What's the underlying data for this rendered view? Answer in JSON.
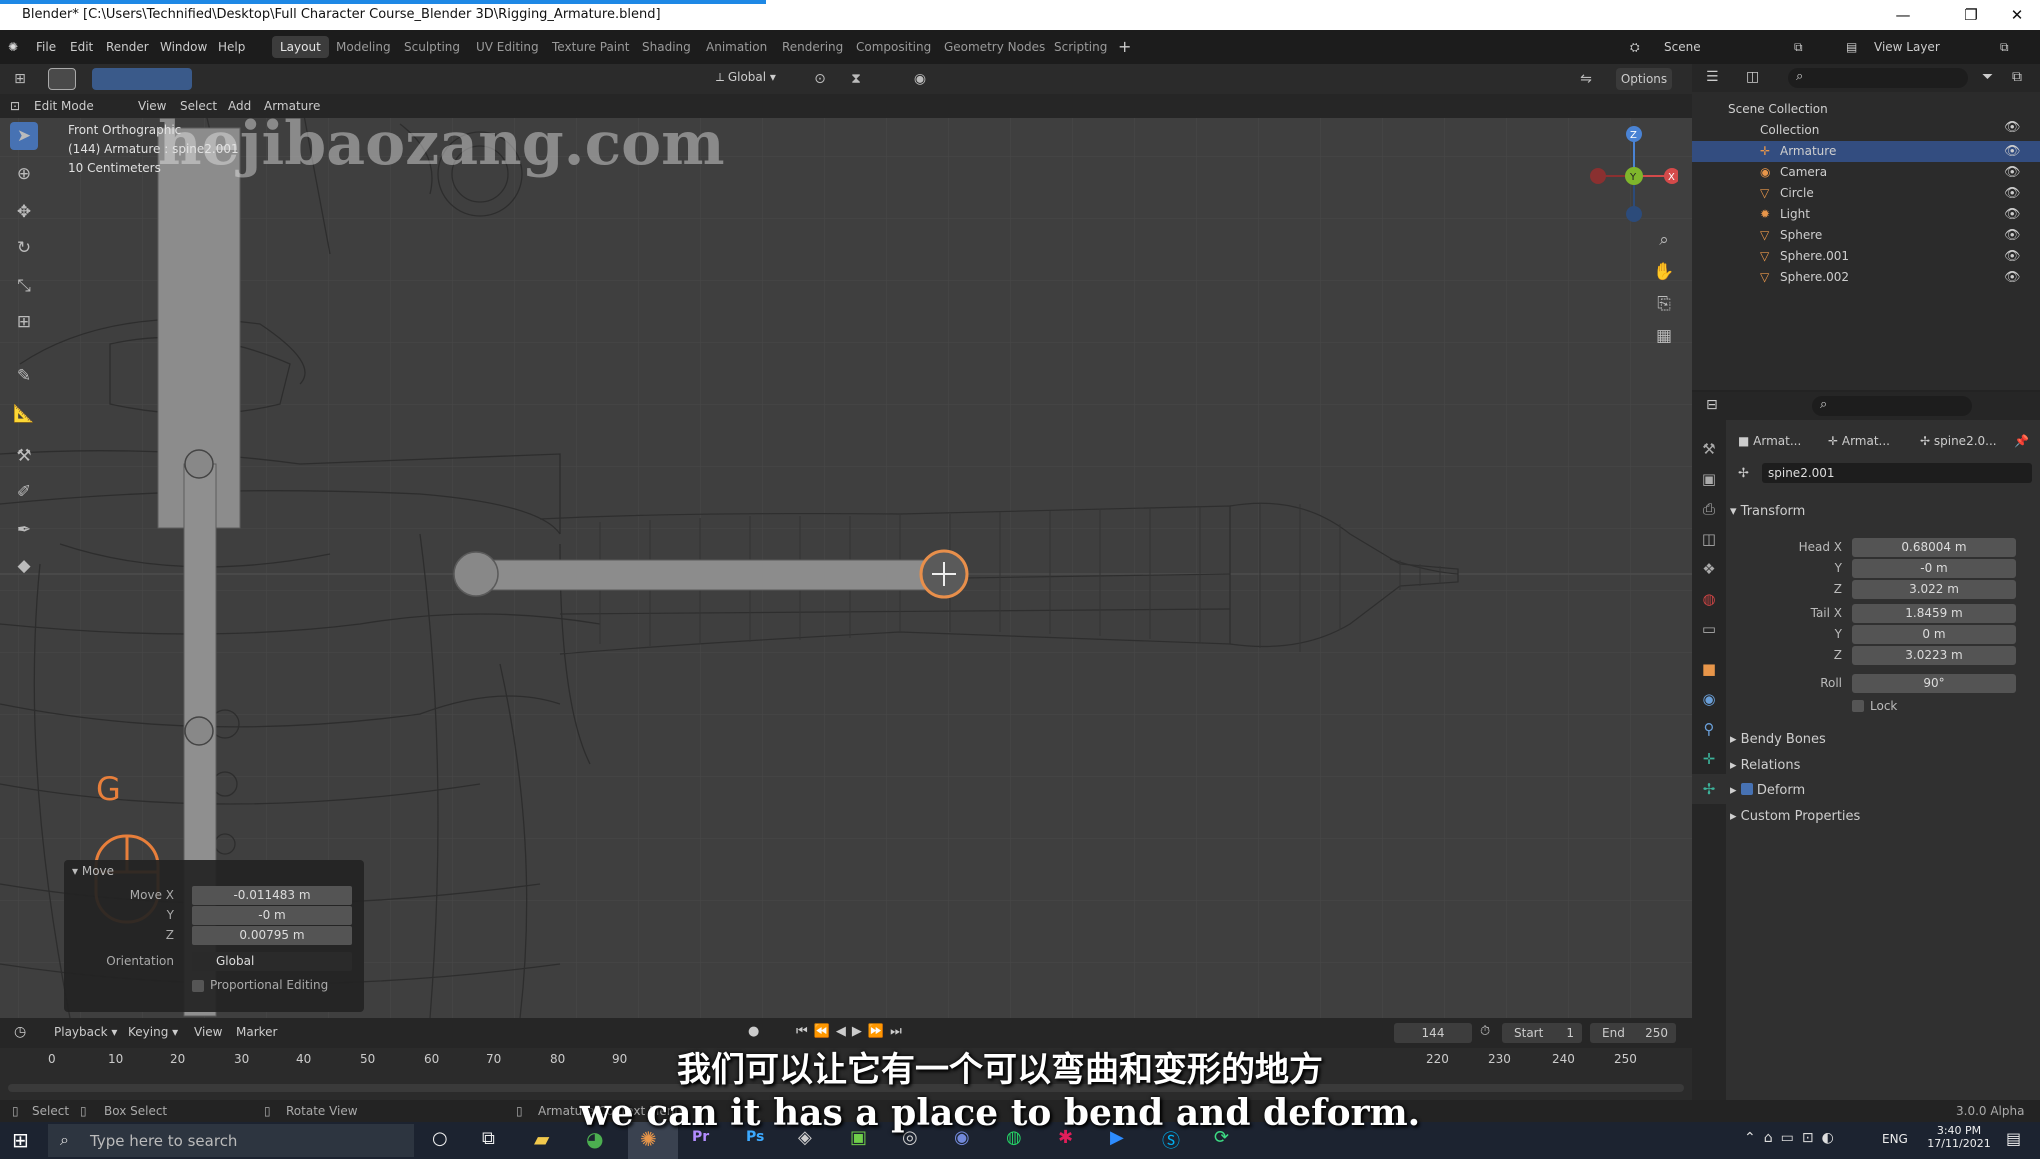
{
  "window": {
    "title": "Blender* [C:\\Users\\Technified\\Desktop\\Full Character Course_Blender 3D\\Rigging_Armature.blend]"
  },
  "menu": [
    "File",
    "Edit",
    "Render",
    "Window",
    "Help"
  ],
  "workspaces": [
    "Layout",
    "Modeling",
    "Sculpting",
    "UV Editing",
    "Texture Paint",
    "Shading",
    "Animation",
    "Rendering",
    "Compositing",
    "Geometry Nodes",
    "Scripting"
  ],
  "topright": {
    "scene": "Scene",
    "view_layer": "View Layer"
  },
  "header": {
    "orientation": "Global",
    "options": "Options"
  },
  "viewport_menu": {
    "mode": "Edit Mode",
    "items": [
      "View",
      "Select",
      "Add",
      "Armature"
    ]
  },
  "overlay": {
    "line1": "Front Orthographic",
    "line2": "(144) Armature : spine2.001",
    "line3": "10 Centimeters",
    "key": "G",
    "watermark": "hejibaozang.com"
  },
  "outliner": {
    "scene_collection": "Scene Collection",
    "collection": "Collection",
    "items": [
      "Armature",
      "Camera",
      "Circle",
      "Light",
      "Sphere",
      "Sphere.001",
      "Sphere.002"
    ]
  },
  "props": {
    "breadcrumb": [
      "Armat...",
      "Armat...",
      "spine2.0..."
    ],
    "bone_name": "spine2.001",
    "transform": "Transform",
    "head_label": "Head X",
    "tail_label": "Tail X",
    "y": "Y",
    "z": "Z",
    "roll_label": "Roll",
    "lock": "Lock",
    "head": [
      "0.68004 m",
      "-0 m",
      "3.022 m"
    ],
    "tail": [
      "1.8459 m",
      "0 m",
      "3.0223 m"
    ],
    "roll": "90°",
    "sections": [
      "Bendy Bones",
      "Relations",
      "Deform",
      "Custom Properties"
    ]
  },
  "move": {
    "title": "Move",
    "move_x": "Move X",
    "y": "Y",
    "z": "Z",
    "vals": [
      "-0.011483 m",
      "-0 m",
      "0.00795 m"
    ],
    "orientation_label": "Orientation",
    "orientation": "Global",
    "proportional": "Proportional Editing"
  },
  "timeline": {
    "playback": "Playback",
    "keying": "Keying",
    "view": "View",
    "marker": "Marker",
    "frame": "144",
    "start_label": "Start",
    "start": "1",
    "end_label": "End",
    "end": "250",
    "ticks": [
      "0",
      "10",
      "20",
      "30",
      "40",
      "50",
      "60",
      "70",
      "80",
      "90",
      "220",
      "230",
      "240",
      "250"
    ]
  },
  "status": {
    "select": "Select",
    "box_select": "Box Select",
    "rotate": "Rotate View",
    "context": "Armature Context Menu",
    "version": "3.0.0 Alpha"
  },
  "taskbar": {
    "search": "Type here to search",
    "lang": "ENG",
    "time": "3:40 PM",
    "date": "17/11/2021"
  },
  "subtitles": {
    "zh": "我们可以让它有一个可以弯曲和变形的地方",
    "en": "we can it has a place to bend and deform."
  }
}
